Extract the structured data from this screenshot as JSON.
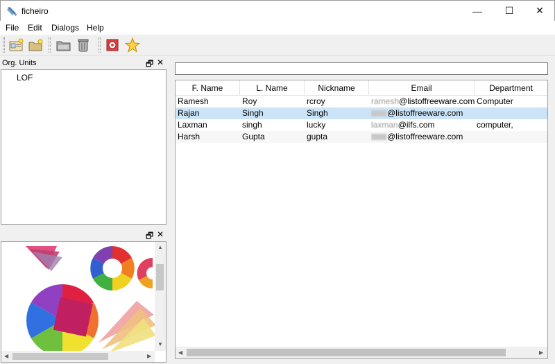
{
  "window": {
    "title": "ficheiro",
    "minimize": "—",
    "maximize": "☐",
    "close": "✕"
  },
  "menu": [
    "File",
    "Edit",
    "Dialogs",
    "Help"
  ],
  "panels": {
    "org_units": {
      "title": "Org. Units",
      "float_glyph": "🗗",
      "close_glyph": "✕",
      "items": [
        "LOF"
      ]
    },
    "image": {
      "float_glyph": "🗗",
      "close_glyph": "✕"
    }
  },
  "search": {
    "value": ""
  },
  "table": {
    "columns": [
      "F. Name",
      "L. Name",
      "Nickname",
      "Email",
      "Department"
    ],
    "rows": [
      {
        "fname": "Ramesh",
        "lname": "Roy",
        "nick": "rcroy",
        "email": "@listoffreeware.com",
        "email_prefix": "ramesh",
        "dept": "Computer"
      },
      {
        "fname": "Rajan",
        "lname": "Singh",
        "nick": "Singh",
        "email": "@listoffreeware.com",
        "email_prefix": "",
        "dept": ""
      },
      {
        "fname": "Laxman",
        "lname": "singh",
        "nick": "lucky",
        "email": "@ilfs.com",
        "email_prefix": "laxman",
        "dept": "computer,"
      },
      {
        "fname": "Harsh",
        "lname": "Gupta",
        "nick": "gupta",
        "email": "@listoffreeware.com",
        "email_prefix": "",
        "dept": ""
      }
    ]
  },
  "colors": {
    "selection": "#cce4f7",
    "border": "#a0a0a0"
  }
}
